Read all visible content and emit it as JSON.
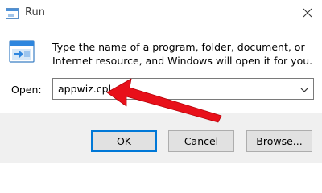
{
  "window": {
    "title": "Run",
    "description": "Type the name of a program, folder, document, or Internet resource, and Windows will open it for you."
  },
  "open": {
    "label": "Open:",
    "value": "appwiz.cpl"
  },
  "buttons": {
    "ok": "OK",
    "cancel": "Cancel",
    "browse": "Browse..."
  },
  "icons": {
    "app": "run-app-icon",
    "run": "run-program-icon",
    "close": "close-icon",
    "dropdown": "chevron-down-icon",
    "annotation": "red-arrow-annotation"
  },
  "colors": {
    "accent": "#0078d7",
    "annotation": "#e8101a",
    "footer": "#f0f0f0"
  }
}
